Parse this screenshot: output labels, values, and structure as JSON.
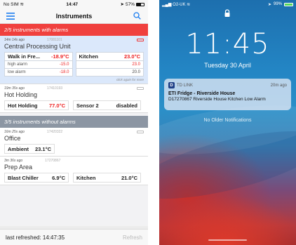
{
  "left": {
    "status": {
      "carrier": "No SIM",
      "time": "14:47",
      "battery": "57%",
      "battery_level": 0.57
    },
    "nav": {
      "title": "Instruments"
    },
    "alarm_header": "2/5 instruments with alarms",
    "noalarm_header": "3/5 instruments without alarms",
    "cards": {
      "cpu": {
        "ago": "14m 14s ago",
        "serial": "17081101",
        "name": "Central Processing Unit",
        "s1_label": "Walk in Fre...",
        "s1_value": "-18.9°C",
        "s1_high_label": "high alarm",
        "s1_high": "-15.0",
        "s1_low_label": "low alarm",
        "s1_low": "-18.0",
        "s2_label": "Kitchen",
        "s2_value": "23.0°C",
        "s2_high": "23.0",
        "s2_low": "20.0",
        "hint": "click again for more"
      },
      "hot": {
        "ago": "19m 35s ago",
        "serial": "17410193",
        "name": "Hot Holding",
        "s1_label": "Hot Holding",
        "s1_value": "77.0°C",
        "s2_label": "Sensor 2",
        "s2_value": "disabled"
      },
      "office": {
        "ago": "16m 25s ago",
        "serial": "17420322",
        "name": "Office",
        "s1_label": "Ambient",
        "s1_value": "23.1°C"
      },
      "prep": {
        "ago": "3m 36s ago",
        "serial": "17270867",
        "name": "Prep Area",
        "s1_label": "Blast Chiller",
        "s1_value": "6.9°C",
        "s2_label": "Kitchen",
        "s2_value": "21.0°C"
      }
    },
    "footer": {
      "last_refreshed": "last refreshed: 14:47:35",
      "refresh": "Refresh"
    }
  },
  "right": {
    "status": {
      "carrier": "O2-UK",
      "battery": "99%",
      "battery_level": 0.99
    },
    "clock": "11:45",
    "date": "Tuesday 30 April",
    "notification": {
      "app": "TD LINK",
      "app_letter": "D",
      "time": "20m ago",
      "title": "ETI Fridge - Riverside House",
      "body": "D17270867 Riverside House Kitchen Low Alarm"
    },
    "no_older": "No Older Notifications"
  },
  "colors": {
    "alarm_red": "#f0403e",
    "noalarm_grey": "#8c96a3",
    "card_alarm_bg": "#dbe8fb",
    "value_red": "#e22222",
    "ios_blue": "#1a7cf0"
  }
}
